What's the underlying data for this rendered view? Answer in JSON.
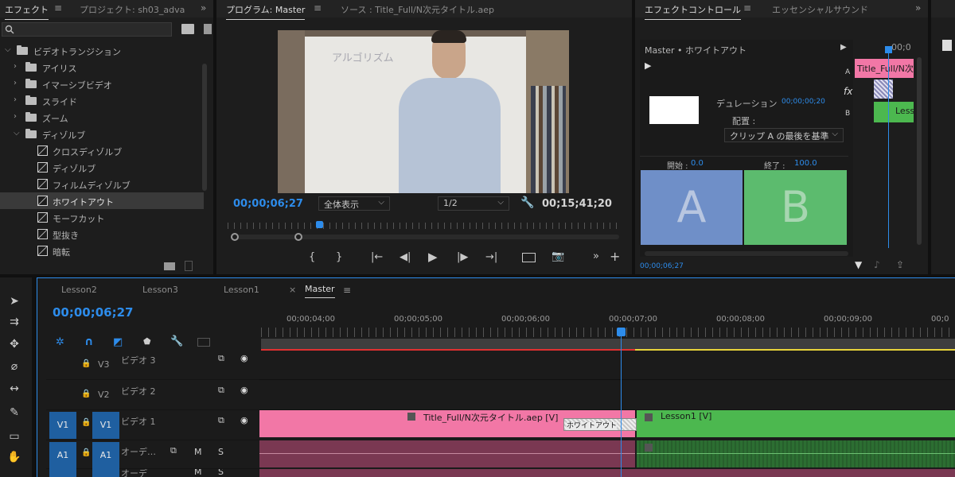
{
  "effects_panel": {
    "tabs": [
      "エフェクト",
      "プロジェクト: sh03_adva"
    ],
    "menu_glyph": "≡",
    "more_glyph": "»",
    "items": [
      {
        "label": "ビデオトランジション",
        "kind": "folder",
        "expanded": true
      },
      {
        "label": "アイリス",
        "kind": "folder"
      },
      {
        "label": "イマーシブビデオ",
        "kind": "folder"
      },
      {
        "label": "スライド",
        "kind": "folder"
      },
      {
        "label": "ズーム",
        "kind": "folder"
      },
      {
        "label": "ディゾルブ",
        "kind": "folder",
        "expanded": true
      },
      {
        "label": "クロスディゾルブ",
        "kind": "effect"
      },
      {
        "label": "ディゾルブ",
        "kind": "effect"
      },
      {
        "label": "フィルムディゾルブ",
        "kind": "effect"
      },
      {
        "label": "ホワイトアウト",
        "kind": "effect",
        "selected": true
      },
      {
        "label": "モーフカット",
        "kind": "effect"
      },
      {
        "label": "型抜き",
        "kind": "effect"
      },
      {
        "label": "暗転",
        "kind": "effect"
      }
    ]
  },
  "program_monitor": {
    "tabs": [
      "プログラム: Master",
      "ソース : Title_Full/N次元タイトル.aep"
    ],
    "video_whiteboard_text": "アルゴリズム",
    "current_time": "00;00;06;27",
    "zoom_label": "全体表示",
    "resolution_label": "1/2",
    "duration": "00;15;41;20"
  },
  "effect_controls": {
    "tabs": [
      "エフェクトコントロール",
      "エッセンシャルサウンド"
    ],
    "header": "Master • ホワイトアウト",
    "mini_clip_top": "Title_Full/N次",
    "mini_clip_bottom": "Less",
    "track_a": "A",
    "track_b": "B",
    "fx_glyph": "fx",
    "duration_label": "デュレーション",
    "duration_value": "00;00;00;20",
    "alignment_label": "配置 :",
    "alignment_value": "クリップ A の最後を基準",
    "start_label": "開始 :",
    "start_value": "0.0",
    "end_label": "終了 :",
    "end_value": "100.0",
    "a_label": "A",
    "b_label": "B",
    "time_small": "00;00;06;27",
    "ruler_mini": "00;0"
  },
  "timeline": {
    "tabs": [
      "Lesson2",
      "Lesson3",
      "Lesson1",
      "Master"
    ],
    "close_glyph": "×",
    "current_time": "00;00;06;27",
    "ruler": [
      "00;00;04;00",
      "00;00;05;00",
      "00;00;06;00",
      "00;00;07;00",
      "00;00;08;00",
      "00;00;09;00",
      "00;0"
    ],
    "tracks": [
      {
        "id": "V3",
        "name": "ビデオ 3"
      },
      {
        "id": "V2",
        "name": "ビデオ 2"
      },
      {
        "id": "V1",
        "name": "ビデオ 1",
        "src": "V1"
      },
      {
        "id": "A1",
        "name": "オーデ…",
        "src": "A1",
        "m": "M",
        "s": "S"
      }
    ],
    "clips": {
      "title": "Title_Full/N次元タイトル.aep [V]",
      "transition": "ホワイトアウト",
      "lesson": "Lesson1 [V]"
    },
    "sixth_label": "オーデ",
    "sixth_m": "M",
    "sixth_s": "S"
  },
  "colors": {
    "accent": "#2d8ceb",
    "pink_clip": "#f277a6",
    "green_clip": "#4cb84f",
    "audio_pink": "#7a3852",
    "audio_green": "#2c6e32",
    "panel_bg": "#1d1d1d"
  }
}
